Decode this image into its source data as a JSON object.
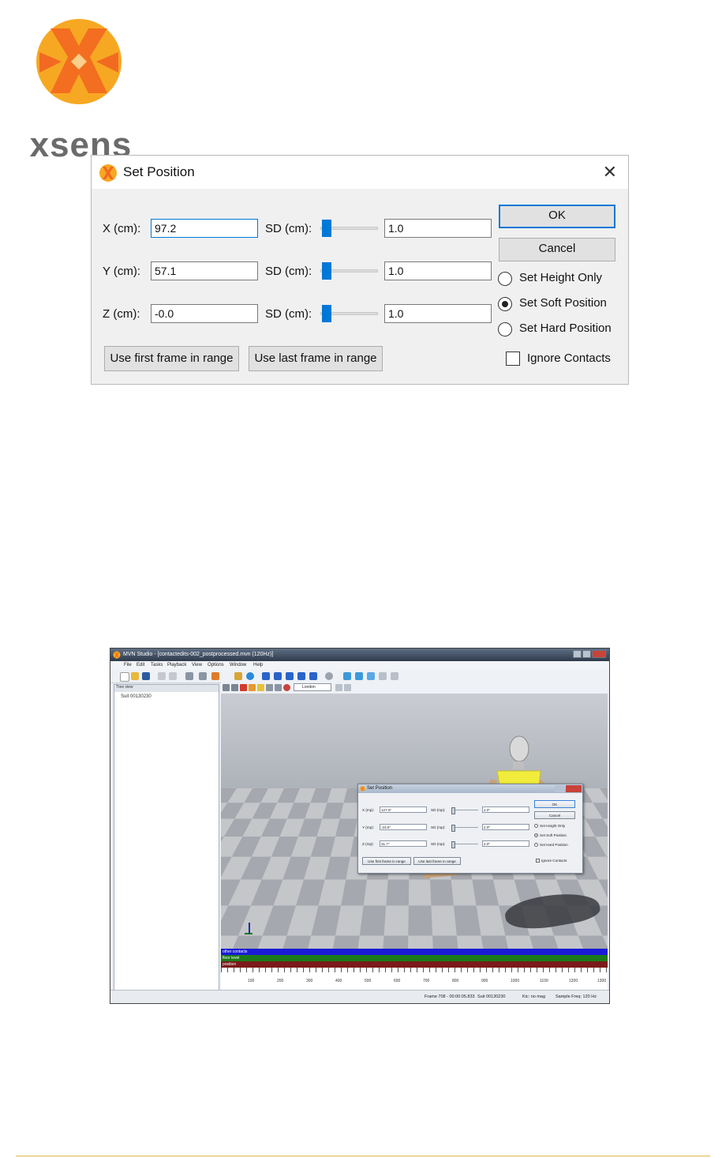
{
  "brand": {
    "logo_word": "xsens",
    "logo_colors": {
      "orange": "#f26a21",
      "yellow": "#f7a823"
    }
  },
  "dialog": {
    "title": "Set Position",
    "close_icon": "close-icon",
    "rows": [
      {
        "axis_label": "X (cm):",
        "value": "97.2",
        "sd_label": "SD (cm):",
        "sd_value": "1.0"
      },
      {
        "axis_label": "Y (cm):",
        "value": "57.1",
        "sd_label": "SD (cm):",
        "sd_value": "1.0"
      },
      {
        "axis_label": "Z (cm):",
        "value": "-0.0",
        "sd_label": "SD (cm):",
        "sd_value": "1.0"
      }
    ],
    "ok_label": "OK",
    "cancel_label": "Cancel",
    "options": [
      {
        "label": "Set Height Only",
        "selected": false
      },
      {
        "label": "Set Soft Position",
        "selected": true
      },
      {
        "label": "Set Hard Position",
        "selected": false
      }
    ],
    "ignore_contacts_label": "Ignore Contacts",
    "ignore_contacts_checked": false,
    "use_first_label": "Use first frame in range",
    "use_last_label": "Use last frame in range",
    "accent": "#0078d7"
  },
  "screenshot": {
    "window_title": "MVN Studio - [contactedits-002_postprocessed.mvn  (120Hz)]",
    "menu": [
      "File",
      "Edit",
      "Tasks",
      "Playback",
      "View",
      "Options",
      "Window",
      "Help"
    ],
    "tree_header": "Tree view",
    "tree_item": "Suit 00130230",
    "view_dropdown": "London",
    "dialog": {
      "title": "Set Position",
      "rows": [
        {
          "axis_label": "X (mp):",
          "value": "127.5\"",
          "sd_label": "SD (mp):",
          "sd_value": "2.0\""
        },
        {
          "axis_label": "Y (mp):",
          "value": "-15.5\"",
          "sd_label": "SD (mp):",
          "sd_value": "2.0\""
        },
        {
          "axis_label": "Z (mp):",
          "value": "31.7\"",
          "sd_label": "SD (mp):",
          "sd_value": "2.0\""
        }
      ],
      "ok_label": "OK",
      "cancel_label": "Cancel",
      "options": [
        "Set Height Only",
        "Set Soft Position",
        "Set Hard Position"
      ],
      "ignore_contacts_label": "Ignore Contacts",
      "use_first_label": "Use first frame in range",
      "use_last_label": "Use last frame in range"
    },
    "timeline_rows": [
      {
        "label": "other contacts",
        "color": "#1a1ad6"
      },
      {
        "label": "floor level",
        "color": "#1a7a1a"
      },
      {
        "label": "position",
        "color": "#7a1a1a"
      }
    ],
    "timeline_ticks": [
      "100",
      "200",
      "300",
      "400",
      "500",
      "600",
      "700",
      "800",
      "900",
      "1000",
      "1100",
      "1200",
      "1300"
    ],
    "status": {
      "frame": "Frame 708 - 00:00:05.833",
      "suit": "Suit 00130230",
      "kic": "Kic: no mag",
      "sample_freq": "Sample Freq: 120 Hz"
    }
  }
}
